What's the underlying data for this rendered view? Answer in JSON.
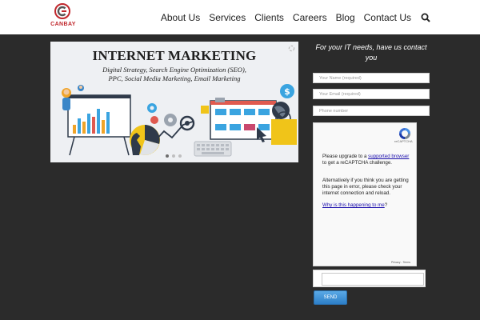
{
  "brand": {
    "name": "CANBAY",
    "color": "#c0282d"
  },
  "nav": {
    "items": [
      "About Us",
      "Services",
      "Clients",
      "Careers",
      "Blog",
      "Contact Us"
    ],
    "search_icon": "search-icon"
  },
  "banner": {
    "title": "INTERNET MARKETING",
    "subtitle_line1": "Digital Strategy, Search Engine Optimization (SEO),",
    "subtitle_line2": "PPC, Social Media Marketing, Email Marketing",
    "slide_count": 3,
    "active_slide": 1
  },
  "form": {
    "heading": "For your IT needs, have us contact you",
    "name_placeholder": "Your Name (required)",
    "email_placeholder": "Your Email (required)",
    "phone_placeholder": "Phone number",
    "send_label": "SEND"
  },
  "recaptcha": {
    "brand": "reCAPTCHA",
    "msg_prefix": "Please upgrade to a ",
    "msg_link": "supported browser",
    "msg_suffix": " to get a reCAPTCHA challenge.",
    "msg2": "Alternatively if you think you are getting this page in error, please check your internet connection and reload.",
    "why_link": "Why is this happening to me",
    "why_suffix": "?",
    "footer": "Privacy - Terms"
  },
  "colors": {
    "background": "#2b2b2b",
    "header": "#ffffff",
    "accent": "#2d7fc8"
  }
}
